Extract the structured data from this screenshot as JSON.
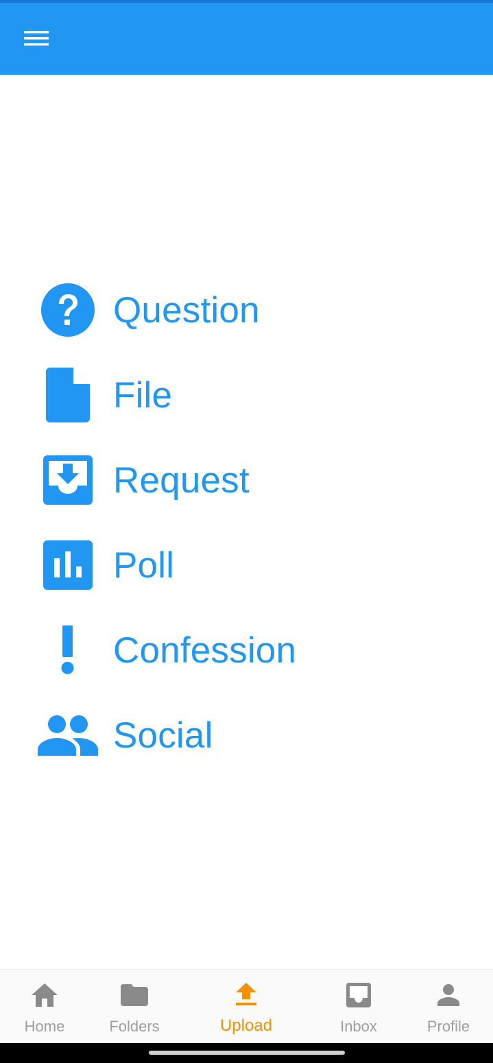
{
  "app_bar": {
    "color": "#2196f3",
    "menu_icon": "hamburger-menu-icon"
  },
  "menu": {
    "accent_color": "#2196f3",
    "items": [
      {
        "label": "Question",
        "icon": "help-circle-icon"
      },
      {
        "label": "File",
        "icon": "file-icon"
      },
      {
        "label": "Request",
        "icon": "inbox-download-icon"
      },
      {
        "label": "Poll",
        "icon": "poll-chart-icon"
      },
      {
        "label": "Confession",
        "icon": "exclamation-icon"
      },
      {
        "label": "Social",
        "icon": "people-icon"
      }
    ]
  },
  "bottom_nav": {
    "active_color": "#f39200",
    "inactive_color": "#9e9e9e",
    "items": [
      {
        "label": "Home",
        "icon": "home-icon",
        "active": false
      },
      {
        "label": "Folders",
        "icon": "folder-icon",
        "active": false
      },
      {
        "label": "Upload",
        "icon": "upload-icon",
        "active": true
      },
      {
        "label": "Inbox",
        "icon": "inbox-icon",
        "active": false
      },
      {
        "label": "Profile",
        "icon": "person-icon",
        "active": false
      }
    ]
  }
}
